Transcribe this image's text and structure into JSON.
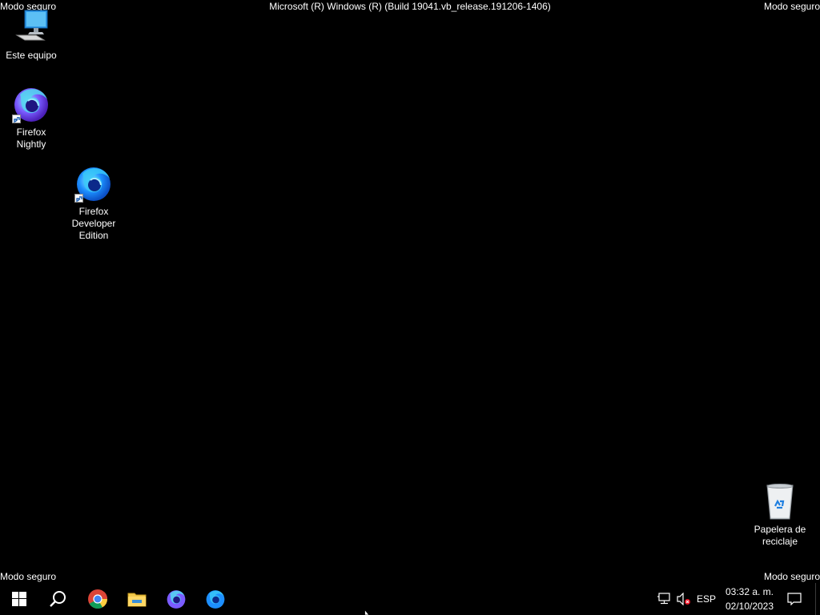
{
  "watermark": {
    "top_left": "Modo seguro",
    "top_right": "Modo seguro",
    "bottom_left": "Modo seguro",
    "bottom_right": "Modo seguro",
    "build": "Microsoft (R) Windows (R) (Build 19041.vb_release.191206-1406)"
  },
  "desktop_icons": [
    {
      "label": "Este equipo",
      "icon": "this-pc-icon"
    },
    {
      "label": "Firefox Nightly",
      "icon": "firefox-nightly-icon",
      "shortcut": true
    },
    {
      "label": "Firefox Developer Edition",
      "icon": "firefox-developer-icon",
      "shortcut": true
    },
    {
      "label": "Papelera de reciclaje",
      "icon": "recycle-bin-icon"
    }
  ],
  "taskbar": {
    "buttons": [
      {
        "name": "start",
        "icon": "windows-logo-icon"
      },
      {
        "name": "search",
        "icon": "search-icon"
      },
      {
        "name": "chrome",
        "icon": "chrome-icon"
      },
      {
        "name": "file-explorer",
        "icon": "folder-icon"
      },
      {
        "name": "firefox-nightly",
        "icon": "firefox-nightly-icon"
      },
      {
        "name": "firefox-developer",
        "icon": "firefox-developer-icon"
      }
    ],
    "tray": {
      "network_icon": "network-icon",
      "volume_icon": "volume-muted-icon",
      "language": "ESP",
      "time": "03:32 a. m.",
      "date": "02/10/2023",
      "notifications_icon": "notification-icon"
    }
  },
  "colors": {
    "background": "#000000",
    "text": "#ffffff",
    "firefox_blue": "#1d7fe6",
    "nightly_purple": "#7b4dff",
    "muted_red": "#e81123"
  }
}
